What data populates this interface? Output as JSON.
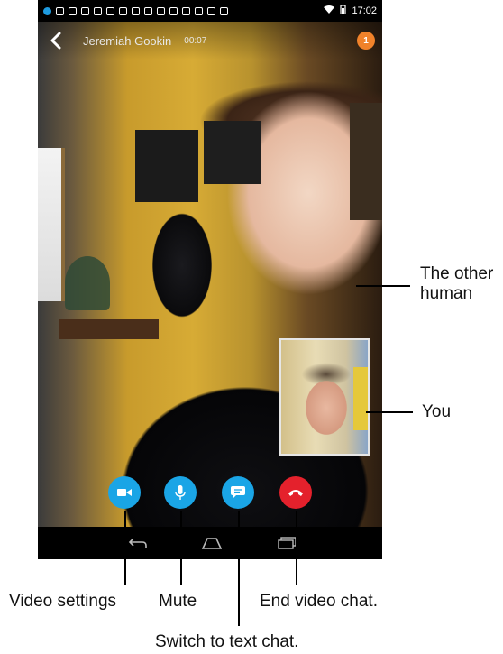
{
  "status_bar": {
    "time": "17:02"
  },
  "call": {
    "caller_name": "Jeremiah Gookin",
    "duration": "00:07",
    "notification_count": "1"
  },
  "controls": {
    "video_icon": "video-camera-icon",
    "mute_icon": "microphone-icon",
    "chat_icon": "chat-bubble-icon",
    "end_icon": "phone-hangup-icon"
  },
  "annotations": {
    "other_human": "The other\nhuman",
    "you": "You",
    "video_settings": "Video settings",
    "mute": "Mute",
    "end_video_chat": "End video chat.",
    "switch_to_text": "Switch to text chat."
  },
  "colors": {
    "accent_blue": "#1aa5e6",
    "end_red": "#e4212c",
    "badge_orange": "#f0822a"
  }
}
